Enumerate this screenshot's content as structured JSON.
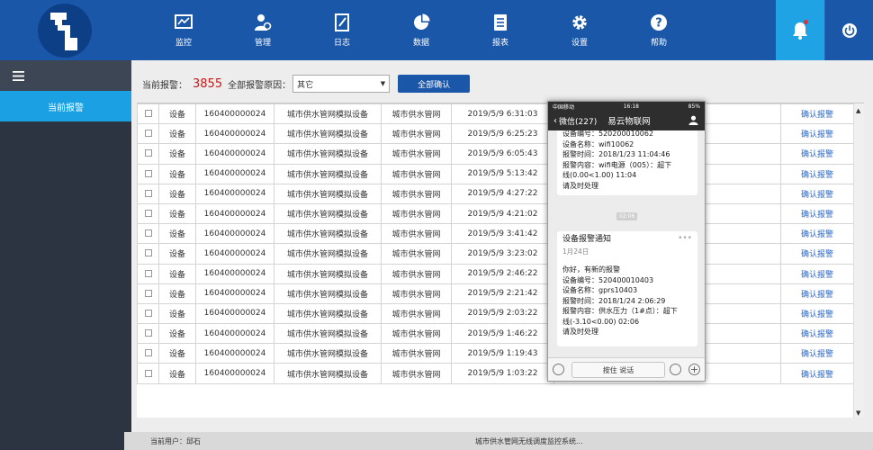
{
  "header": {
    "nav": [
      {
        "label": "监控",
        "icon": "monitor-chart-icon"
      },
      {
        "label": "管理",
        "icon": "user-gear-icon"
      },
      {
        "label": "日志",
        "icon": "log-book-icon"
      },
      {
        "label": "数据",
        "icon": "pie-chart-icon"
      },
      {
        "label": "报表",
        "icon": "report-list-icon"
      },
      {
        "label": "设置",
        "icon": "gear-icon"
      },
      {
        "label": "帮助",
        "icon": "help-icon"
      }
    ]
  },
  "sidebar": {
    "items": [
      {
        "label": "当前报警",
        "active": true
      }
    ]
  },
  "toolbar": {
    "current_alarm_label": "当前报警：",
    "alarm_count": "3855",
    "reason_label": "全部报警原因：",
    "reason_value": "其它",
    "confirm_all_label": "全部确认"
  },
  "table": {
    "rows": [
      {
        "type": "设备",
        "id": "160400000024",
        "name": "城市供水管网模拟设备",
        "network": "城市供水管网",
        "time": "2019/5/9 6:31:03",
        "action": "确认报警"
      },
      {
        "type": "设备",
        "id": "160400000024",
        "name": "城市供水管网模拟设备",
        "network": "城市供水管网",
        "time": "2019/5/9 6:25:23",
        "action": "确认报警"
      },
      {
        "type": "设备",
        "id": "160400000024",
        "name": "城市供水管网模拟设备",
        "network": "城市供水管网",
        "time": "2019/5/9 6:05:43",
        "action": "确认报警"
      },
      {
        "type": "设备",
        "id": "160400000024",
        "name": "城市供水管网模拟设备",
        "network": "城市供水管网",
        "time": "2019/5/9 5:13:42",
        "action": "确认报警"
      },
      {
        "type": "设备",
        "id": "160400000024",
        "name": "城市供水管网模拟设备",
        "network": "城市供水管网",
        "time": "2019/5/9 4:27:22",
        "action": "确认报警"
      },
      {
        "type": "设备",
        "id": "160400000024",
        "name": "城市供水管网模拟设备",
        "network": "城市供水管网",
        "time": "2019/5/9 4:21:02",
        "action": "确认报警"
      },
      {
        "type": "设备",
        "id": "160400000024",
        "name": "城市供水管网模拟设备",
        "network": "城市供水管网",
        "time": "2019/5/9 3:41:42",
        "action": "确认报警"
      },
      {
        "type": "设备",
        "id": "160400000024",
        "name": "城市供水管网模拟设备",
        "network": "城市供水管网",
        "time": "2019/5/9 3:23:02",
        "action": "确认报警"
      },
      {
        "type": "设备",
        "id": "160400000024",
        "name": "城市供水管网模拟设备",
        "network": "城市供水管网",
        "time": "2019/5/9 2:46:22",
        "action": "确认报警"
      },
      {
        "type": "设备",
        "id": "160400000024",
        "name": "城市供水管网模拟设备",
        "network": "城市供水管网",
        "time": "2019/5/9 2:21:42",
        "action": "确认报警"
      },
      {
        "type": "设备",
        "id": "160400000024",
        "name": "城市供水管网模拟设备",
        "network": "城市供水管网",
        "time": "2019/5/9 2:03:22",
        "action": "确认报警"
      },
      {
        "type": "设备",
        "id": "160400000024",
        "name": "城市供水管网模拟设备",
        "network": "城市供水管网",
        "time": "2019/5/9 1:46:22",
        "action": "确认报警"
      },
      {
        "type": "设备",
        "id": "160400000024",
        "name": "城市供水管网模拟设备",
        "network": "城市供水管网",
        "time": "2019/5/9 1:19:43",
        "action": "确认报警"
      },
      {
        "type": "设备",
        "id": "160400000024",
        "name": "城市供水管网模拟设备",
        "network": "城市供水管网",
        "time": "2019/5/9 1:03:22",
        "action": "确认报警"
      }
    ]
  },
  "statusbar": {
    "user": "当前用户：邱石",
    "system_title": "城市供水管网无线调度监控系统..."
  },
  "phone": {
    "status": {
      "carrier": "中国移动",
      "time": "16:18",
      "battery": "85%"
    },
    "header": {
      "back": "微信(227)",
      "chat": "易云物联网"
    },
    "card1": {
      "lines": [
        "设备编号：520200010062",
        "设备名称：wifi10062",
        "报警时间：2018/1/23 11:04:46",
        "报警内容：wifi电源（005）：超下",
        "线(0.00<1.00) 11:04",
        "请及时处理"
      ]
    },
    "time_chip": "02:06",
    "card2": {
      "title": "设备报警通知",
      "date": "1月24日",
      "lines": [
        "你好，有新的报警",
        "设备编号：520400010403",
        "设备名称：gprs10403",
        "报警时间：2018/1/24 2:06:29",
        "报警内容：供水压力（1#点）：超下",
        "线(-3.10<0.00) 02:06",
        "请及时处理"
      ]
    },
    "input": {
      "hold_to_talk": "按住 说话"
    }
  }
}
